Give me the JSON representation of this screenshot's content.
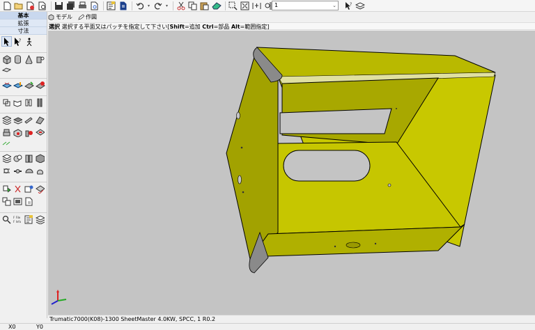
{
  "toolbar": {
    "icons": [
      "new-file-icon",
      "open-folder-icon",
      "import-icon",
      "search-file-icon",
      "save-icon",
      "save-all-icon",
      "print-icon",
      "print-preview-icon",
      "checklist-icon",
      "copy-doc-icon",
      "undo-icon",
      "redo-icon",
      "cut-icon",
      "copy-icon",
      "paste-icon",
      "eraser-icon",
      "zoom-window-icon",
      "zoom-fit-icon",
      "zoom-level-icon",
      "measure-icon",
      "axis-icon",
      "help-pointer-icon",
      "layers-icon"
    ],
    "layer_value": "1"
  },
  "palette": {
    "tabs": [
      "基本",
      "拡張",
      "寸法"
    ]
  },
  "view_tabs": {
    "model": "モデル",
    "drawing": "作図"
  },
  "prompt": {
    "mode": "選択",
    "text": " 選択する平面又はパッチを指定して下さい[",
    "shift_key": "Shift",
    "shift_text": "=追加 ",
    "ctrl_key": "Ctrl",
    "ctrl_text": "=部品 ",
    "alt_key": "Alt",
    "alt_text": "=範囲指定]"
  },
  "status": {
    "machine": "Trumatic7000(K08)-1300 SheetMaster 4.0KW, SPCC, 1 R0.2"
  },
  "coords": {
    "x": "X0",
    "y": "Y0"
  },
  "colors": {
    "part_face": "#b6b600",
    "part_face_light": "#c9c900",
    "part_face_dark": "#9a9a00",
    "background": "#c4c4c4",
    "bend": "#8a8a8a"
  }
}
